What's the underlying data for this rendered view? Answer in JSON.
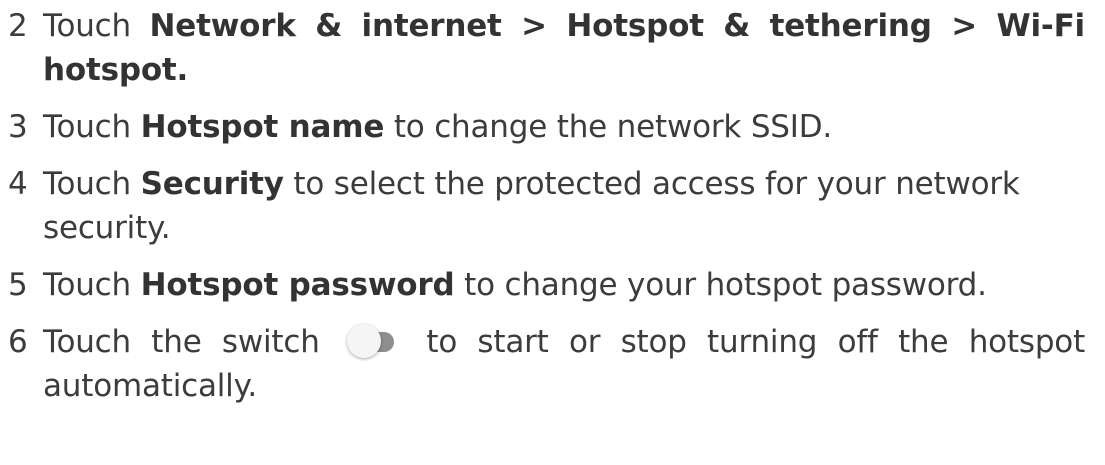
{
  "steps": [
    {
      "number": "2",
      "pre": "Touch ",
      "bold1": "Network & internet",
      "sep1": " > ",
      "bold2": "Hotspot & tethering",
      "sep2": " > ",
      "bold3": "Wi-Fi hotspot."
    },
    {
      "number": "3",
      "pre": "Touch ",
      "bold": "Hotspot name",
      "post": " to change the network SSID."
    },
    {
      "number": "4",
      "pre": "Touch ",
      "bold": "Security",
      "post": " to select the protected access for your network security."
    },
    {
      "number": "5",
      "pre": "Touch ",
      "bold": "Hotspot password",
      "post": " to change your hotspot password."
    },
    {
      "number": "6",
      "pre": "Touch the switch",
      "icon": "toggle-switch-off-icon",
      "post": "to start or stop turning off the hotspot automatically."
    }
  ],
  "colors": {
    "text": "#3c3c3c",
    "switch_track": "#8e8e8e",
    "switch_knob": "#f5f5f5"
  }
}
